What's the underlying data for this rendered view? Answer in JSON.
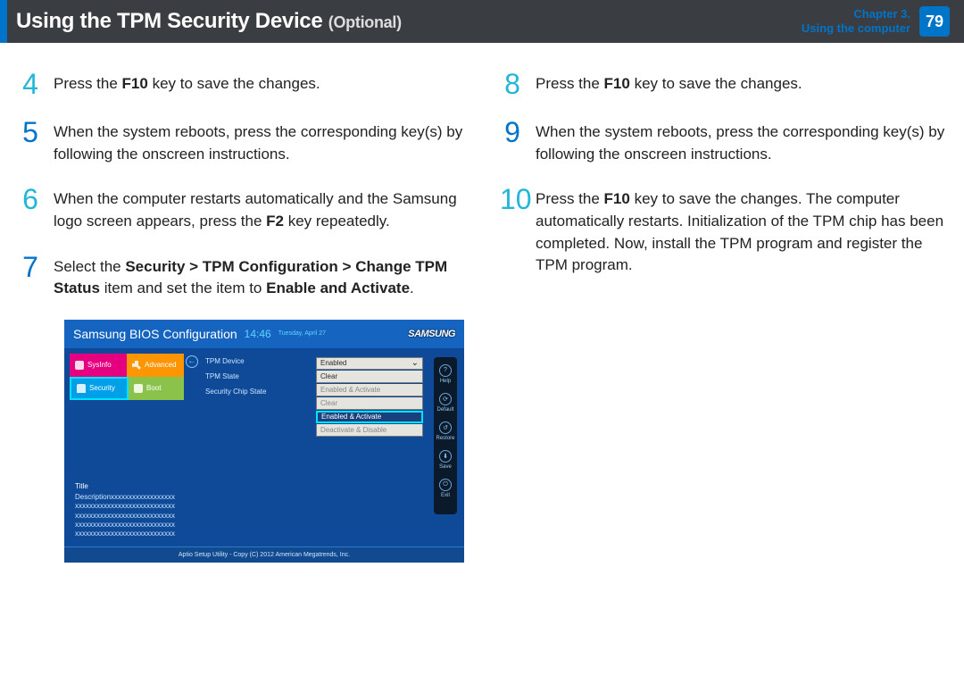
{
  "header": {
    "title": "Using the TPM Security Device",
    "subtitle": "(Optional)",
    "chapter_line1": "Chapter 3.",
    "chapter_line2": "Using the computer",
    "page": "79"
  },
  "left_steps": [
    {
      "n": "4",
      "color": "cyan",
      "html": "Press the <b>F10</b> key to save the changes."
    },
    {
      "n": "5",
      "color": "blue",
      "html": "When the system reboots, press the corresponding key(s) by following the onscreen instructions."
    },
    {
      "n": "6",
      "color": "cyan",
      "html": "When the computer restarts automatically and the Samsung logo screen appears, press the <b>F2</b> key repeatedly."
    },
    {
      "n": "7",
      "color": "blue",
      "html": "Select the <b>Security &gt; TPM Configuration &gt; Change TPM Status</b> item and set the item to <b>Enable and Activate</b>."
    }
  ],
  "right_steps": [
    {
      "n": "8",
      "color": "cyan",
      "html": "Press the <b>F10</b> key to save the changes."
    },
    {
      "n": "9",
      "color": "blue",
      "html": "When the system reboots, press the corresponding key(s) by following the onscreen instructions."
    },
    {
      "n": "10",
      "color": "cyan",
      "html": "Press the <b>F10</b> key to save the changes. The computer automatically restarts. Initialization of the TPM chip has been completed. Now, install the TPM program and register the TPM program."
    }
  ],
  "bios": {
    "title": "Samsung BIOS Configuration",
    "time": "14:46",
    "date": "Tuesday, April 27",
    "logo": "SAMSUNG",
    "tabs": {
      "sysinfo": "SysInfo",
      "advanced": "Advanced",
      "security": "Security",
      "boot": "Boot"
    },
    "fields": {
      "device": "TPM Device",
      "state": "TPM State",
      "chip": "Security Chip State"
    },
    "device_value": "Enabled",
    "dropdown": [
      "Clear",
      "Enabled & Activate",
      "Clear",
      "Enabled & Activate",
      "Deactivate & Disable"
    ],
    "side": {
      "help": "Help",
      "default": "Default",
      "restore": "Restore",
      "save": "Save",
      "exit": "Exit"
    },
    "desc_title": "Title",
    "desc_body": "Descriptionxxxxxxxxxxxxxxxxxx\nxxxxxxxxxxxxxxxxxxxxxxxxxxxx\nxxxxxxxxxxxxxxxxxxxxxxxxxxxx\nxxxxxxxxxxxxxxxxxxxxxxxxxxxx\nxxxxxxxxxxxxxxxxxxxxxxxxxxxx",
    "footer": "Aptio Setup Utility - Copy (C) 2012 American Megatrends, Inc."
  }
}
